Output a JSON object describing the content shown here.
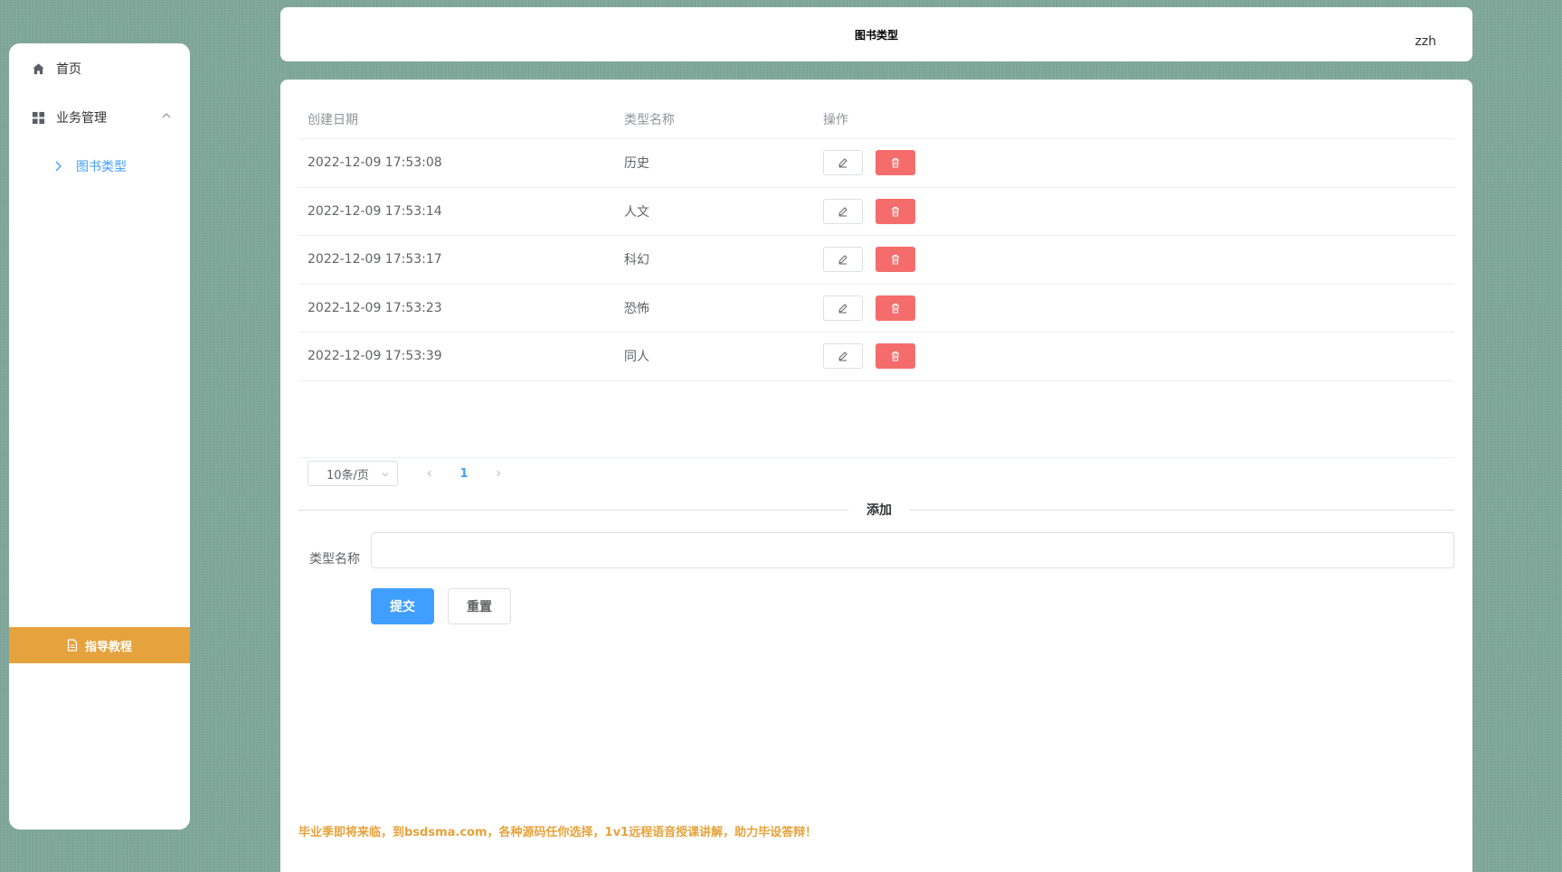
{
  "sidebar": {
    "home": {
      "label": "首页",
      "icon": "home-icon"
    },
    "business": {
      "label": "业务管理",
      "icon": "grid-icon"
    },
    "sub_item": {
      "label": "图书类型",
      "icon": "chevron-right-icon"
    },
    "guide": {
      "label": "指导教程",
      "icon": "document-icon"
    }
  },
  "header": {
    "title": "图书类型",
    "user": "zzh"
  },
  "table": {
    "columns": [
      "创建日期",
      "类型名称",
      "操作"
    ],
    "rows": [
      {
        "date": "2022-12-09 17:53:08",
        "name": "历史"
      },
      {
        "date": "2022-12-09 17:53:14",
        "name": "人文"
      },
      {
        "date": "2022-12-09 17:53:17",
        "name": "科幻"
      },
      {
        "date": "2022-12-09 17:53:23",
        "name": "恐怖"
      },
      {
        "date": "2022-12-09 17:53:39",
        "name": "同人"
      }
    ]
  },
  "pagination": {
    "page_size": "10条/页",
    "current_page": "1"
  },
  "form": {
    "section_title": "添加",
    "field_label": "类型名称",
    "field_value": "",
    "submit_label": "提交",
    "reset_label": "重置"
  },
  "promo": "毕业季即将来临，到bsdsma.com，各种源码任你选择，1v1远程语音授课讲解，助力毕设答辩！",
  "colors": {
    "accent": "#409eff",
    "danger": "#f56c6c",
    "warning": "#e6a23c",
    "background": "#7fa79a"
  }
}
